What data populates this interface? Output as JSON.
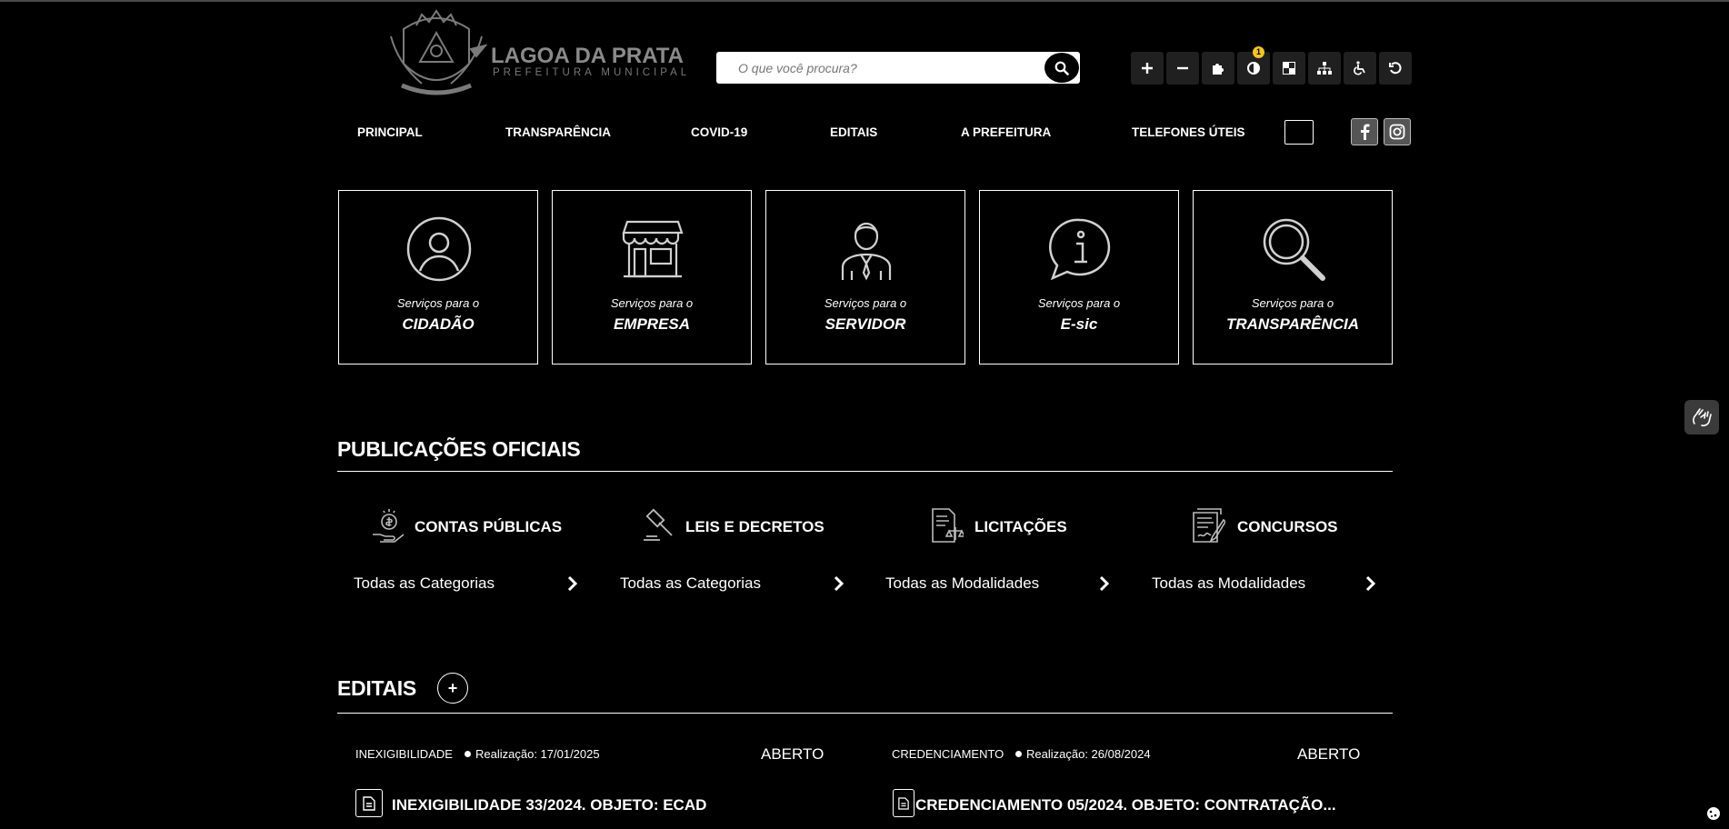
{
  "header": {
    "logo_title": "LAGOA DA PRATA",
    "logo_subtitle": "PREFEITURA MUNICIPAL",
    "search_placeholder": "O que você procura?",
    "accessibility_buttons": [
      {
        "icon": "plus-icon",
        "label": "+"
      },
      {
        "icon": "minus-icon",
        "label": "−"
      },
      {
        "icon": "puzzle-icon"
      },
      {
        "icon": "contrast-icon",
        "badge": "1"
      },
      {
        "icon": "checker-icon"
      },
      {
        "icon": "sitemap-icon"
      },
      {
        "icon": "wheelchair-icon"
      },
      {
        "icon": "reset-icon"
      }
    ]
  },
  "nav": {
    "items": [
      "PRINCIPAL",
      "TRANSPARÊNCIA",
      "COVID-19",
      "EDITAIS",
      "A PREFEITURA",
      "TELEFONES ÚTEIS"
    ],
    "social": [
      "facebook-icon",
      "instagram-icon"
    ]
  },
  "services": [
    {
      "pre": "Serviços para o",
      "title": "CIDADÃO",
      "icon": "user-circle-icon"
    },
    {
      "pre": "Serviços para o",
      "title": "EMPRESA",
      "icon": "storefront-icon"
    },
    {
      "pre": "Serviços para o",
      "title": "SERVIDOR",
      "icon": "employee-icon"
    },
    {
      "pre": "Serviços para o",
      "title": "E-sic",
      "icon": "info-bubble-icon"
    },
    {
      "pre": "Serviços para o",
      "title": "TRANSPARÊNCIA",
      "icon": "magnifier-icon"
    }
  ],
  "publications": {
    "title": "PUBLICAÇÕES OFICIAIS",
    "items": [
      {
        "title": "CONTAS PÚBLICAS",
        "link": "Todas as Categorias",
        "icon": "money-hand-icon"
      },
      {
        "title": "LEIS E DECRETOS",
        "link": "Todas as Categorias",
        "icon": "gavel-icon"
      },
      {
        "title": "LICITAÇÕES",
        "link": "Todas as Modalidades",
        "icon": "document-scale-icon"
      },
      {
        "title": "CONCURSOS",
        "link": "Todas as Modalidades",
        "icon": "contract-pen-icon"
      }
    ]
  },
  "editais": {
    "title": "EDITAIS",
    "plus": "+",
    "items": [
      {
        "type": "INEXIGIBILIDADE",
        "date": "Realização: 17/01/2025",
        "status": "ABERTO",
        "title": "INEXIGIBILIDADE 33/2024. OBJETO: ECAD"
      },
      {
        "type": "CREDENCIAMENTO",
        "date": "Realização: 26/08/2024",
        "status": "ABERTO",
        "title": "CREDENCIAMENTO 05/2024. OBJETO: CONTRATAÇÃO..."
      }
    ]
  }
}
